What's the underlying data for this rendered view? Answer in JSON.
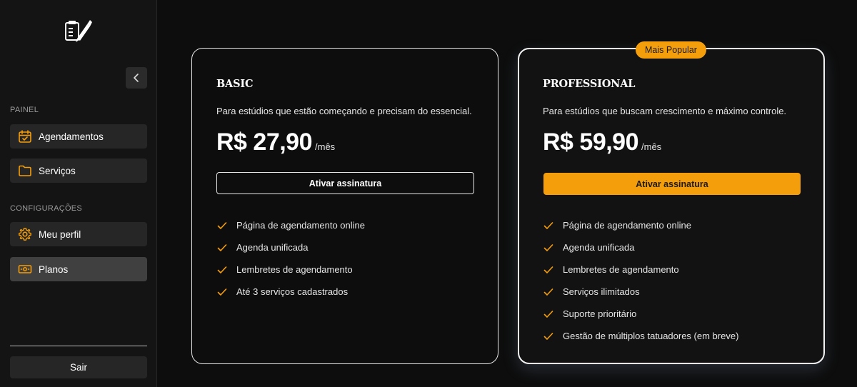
{
  "sidebar": {
    "sections": {
      "panel": "PAINEL",
      "settings": "CONFIGURAÇÕES"
    },
    "items": [
      {
        "label": "Agendamentos",
        "icon": "calendar-check-icon"
      },
      {
        "label": "Serviços",
        "icon": "folder-icon"
      },
      {
        "label": "Meu perfil",
        "icon": "gear-icon"
      },
      {
        "label": "Planos",
        "icon": "banknote-icon",
        "active": true
      }
    ],
    "logout_label": "Sair"
  },
  "plans": [
    {
      "name": "BASIC",
      "description": "Para estúdios que estão começando e precisam do essencial.",
      "price": "R$ 27,90",
      "period": "/mês",
      "button_label": "Ativar assinatura",
      "features": [
        "Página de agendamento online",
        "Agenda unificada",
        "Lembretes de agendamento",
        "Até 3 serviços cadastrados"
      ]
    },
    {
      "name": "PROFESSIONAL",
      "badge": "Mais Popular",
      "description": "Para estúdios que buscam crescimento e máximo controle.",
      "price": "R$ 59,90",
      "period": "/mês",
      "button_label": "Ativar assinatura",
      "features": [
        "Página de agendamento online",
        "Agenda unificada",
        "Lembretes de agendamento",
        "Serviços ilimitados",
        "Suporte prioritário",
        "Gestão de múltiplos tatuadores (em breve)"
      ]
    }
  ],
  "colors": {
    "accent": "#f59e0b",
    "background": "#0d0d0d",
    "sidebar": "#141414"
  }
}
